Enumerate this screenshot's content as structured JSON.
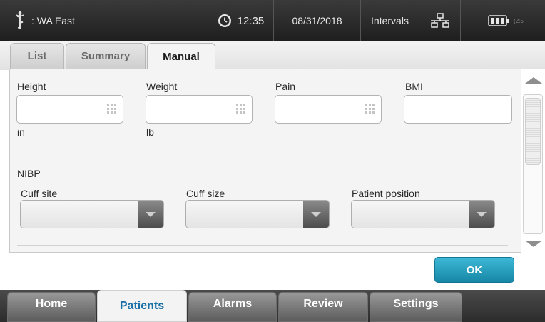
{
  "status_bar": {
    "location": ": WA East",
    "location_icon": "caduceus-icon",
    "clock_icon": "clock-icon",
    "time": "12:35",
    "date": "08/31/2018",
    "mode": "Intervals",
    "network_icon": "network-icon",
    "battery_icon": "battery-icon",
    "battery_extra": "(2:5"
  },
  "top_tabs": [
    {
      "label": "List",
      "active": false
    },
    {
      "label": "Summary",
      "active": false
    },
    {
      "label": "Manual",
      "active": true
    }
  ],
  "form": {
    "height": {
      "label": "Height",
      "value": "",
      "unit": "in"
    },
    "weight": {
      "label": "Weight",
      "value": "",
      "unit": "lb"
    },
    "pain": {
      "label": "Pain",
      "value": ""
    },
    "bmi": {
      "label": "BMI",
      "value": ""
    },
    "nibp_section": "NIBP",
    "cuff_site": {
      "label": "Cuff site",
      "value": ""
    },
    "cuff_size": {
      "label": "Cuff size",
      "value": ""
    },
    "patient_position": {
      "label": "Patient position",
      "value": ""
    }
  },
  "ok_label": "OK",
  "bottom_nav": [
    {
      "label": "Home",
      "active": false
    },
    {
      "label": "Patients",
      "active": true
    },
    {
      "label": "Alarms",
      "active": false
    },
    {
      "label": "Review",
      "active": false
    },
    {
      "label": "Settings",
      "active": false
    }
  ],
  "colors": {
    "accent": "#1e9fc4",
    "active_nav_text": "#1a6fa5",
    "status_bar_bg": "#2a2a2a"
  }
}
